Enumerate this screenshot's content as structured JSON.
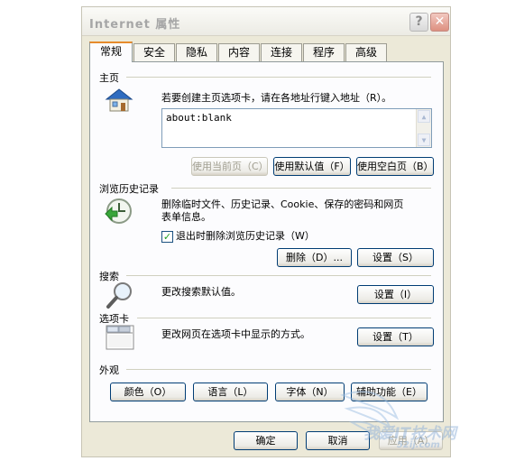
{
  "window": {
    "title": "Internet 属性",
    "help_label": "?",
    "close_label": "✕"
  },
  "tabs": [
    "常规",
    "安全",
    "隐私",
    "内容",
    "连接",
    "程序",
    "高级"
  ],
  "home": {
    "group": "主页",
    "instruction": "若要创建主页选项卡，请在各地址行键入地址（R）。",
    "address": "about:blank",
    "use_current": "使用当前页（C）",
    "use_default": "使用默认值（F）",
    "use_blank": "使用空白页（B）"
  },
  "history": {
    "group": "浏览历史记录",
    "description_line1": "删除临时文件、历史记录、Cookie、保存的密码和网页",
    "description_line2": "表单信息。",
    "checkbox_label": "退出时删除浏览历史记录（W）",
    "checked": true,
    "delete_button": "删除（D）...",
    "settings_button": "设置（S）"
  },
  "search": {
    "group": "搜索",
    "description": "更改搜索默认值。",
    "settings_button": "设置（I）"
  },
  "tabs_section": {
    "group": "选项卡",
    "description": "更改网页在选项卡中显示的方式。",
    "settings_button": "设置（T）"
  },
  "appearance": {
    "group": "外观",
    "colors": "颜色（O）",
    "languages": "语言（L）",
    "fonts": "字体（N）",
    "accessibility": "辅助功能（E）"
  },
  "footer": {
    "ok": "确定",
    "cancel": "取消",
    "apply": "应用（A）"
  },
  "watermark": {
    "line1": "我爱IT技术网",
    "line2": "52ij.com"
  }
}
